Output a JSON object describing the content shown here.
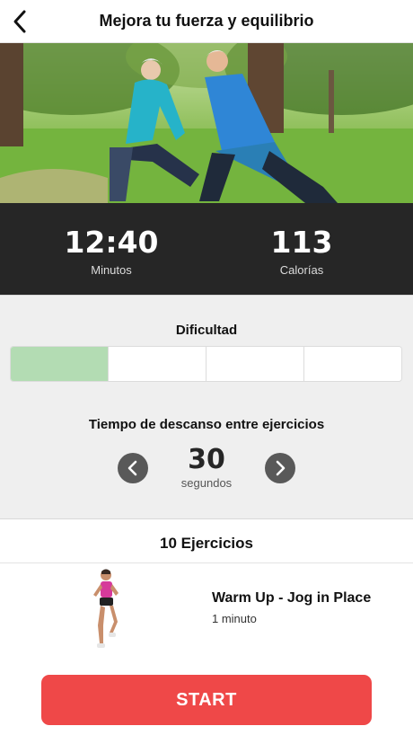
{
  "header": {
    "title": "Mejora tu fuerza y equilibrio"
  },
  "stats": {
    "duration": {
      "value": "12:40",
      "label": "Minutos"
    },
    "calories": {
      "value": "113",
      "label": "Calorías"
    }
  },
  "difficulty": {
    "label": "Dificultad",
    "level": 1,
    "max": 4,
    "active_color": "#b3dcb3"
  },
  "rest": {
    "label": "Tiempo de descanso entre ejercicios",
    "value": "30",
    "unit": "segundos"
  },
  "exercises": {
    "header": "10 Ejercicios",
    "items": [
      {
        "name": "Warm Up - Jog in Place",
        "duration": "1 minuto"
      }
    ]
  },
  "start": {
    "label": "START",
    "color": "#ef4848"
  },
  "icons": {
    "back": "chevron-left-icon",
    "decrease": "chevron-left-icon",
    "increase": "chevron-right-icon"
  }
}
